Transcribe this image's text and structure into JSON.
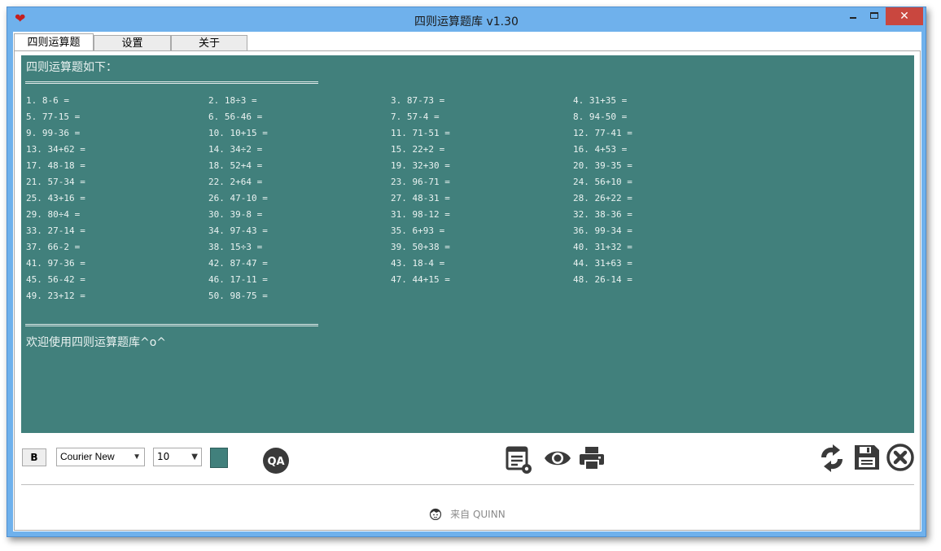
{
  "window": {
    "title": "四则运算题库 v1.30",
    "icon": "heart-icon"
  },
  "tabs": [
    {
      "label": "四则运算题",
      "active": true
    },
    {
      "label": "设置",
      "active": false
    },
    {
      "label": "关于",
      "active": false
    }
  ],
  "output": {
    "header": "四则运算题如下：",
    "separator": "==========================================",
    "problems": [
      "1. 8-6 =",
      "2. 18÷3 =",
      "3. 87-73 =",
      "4. 31+35 =",
      "5. 77-15 =",
      "6. 56-46 =",
      "7. 57-4 =",
      "8. 94-50 =",
      "9. 99-36 =",
      "10. 10+15 =",
      "11. 71-51 =",
      "12. 77-41 =",
      "13. 34+62 =",
      "14. 34÷2 =",
      "15. 22+2 =",
      "16. 4+53 =",
      "17. 48-18 =",
      "18. 52+4 =",
      "19. 32+30 =",
      "20. 39-35 =",
      "21. 57-34 =",
      "22. 2+64 =",
      "23. 96-71 =",
      "24. 56+10 =",
      "25. 43+16 =",
      "26. 47-10 =",
      "27. 48-31 =",
      "28. 26+22 =",
      "29. 80÷4 =",
      "30. 39-8 =",
      "31. 98-12 =",
      "32. 38-36 =",
      "33. 27-14 =",
      "34. 97-43 =",
      "35. 6+93 =",
      "36. 99-34 =",
      "37. 66-2 =",
      "38. 15÷3 =",
      "39. 50+38 =",
      "40. 31+32 =",
      "41. 97-36 =",
      "42. 87-47 =",
      "43. 18-4 =",
      "44. 31+63 =",
      "45. 56-42 =",
      "46. 17-11 =",
      "47. 44+15 =",
      "48. 26-14 =",
      "49. 23+12 =",
      "50. 98-75 ="
    ],
    "welcome": "欢迎使用四则运算题库^o^",
    "background_color": "#41807c"
  },
  "toolbar": {
    "bold_label": "B",
    "font_family_value": "Courier New",
    "font_size_value": "10",
    "swatch_color": "#41807c",
    "icons": [
      "qa-icon",
      "settings-document-icon",
      "eye-icon",
      "printer-icon",
      "refresh-icon",
      "save-icon",
      "close-circle-icon"
    ]
  },
  "footer": {
    "text": "来自 QUINN",
    "icon": "avatar-face-icon"
  }
}
